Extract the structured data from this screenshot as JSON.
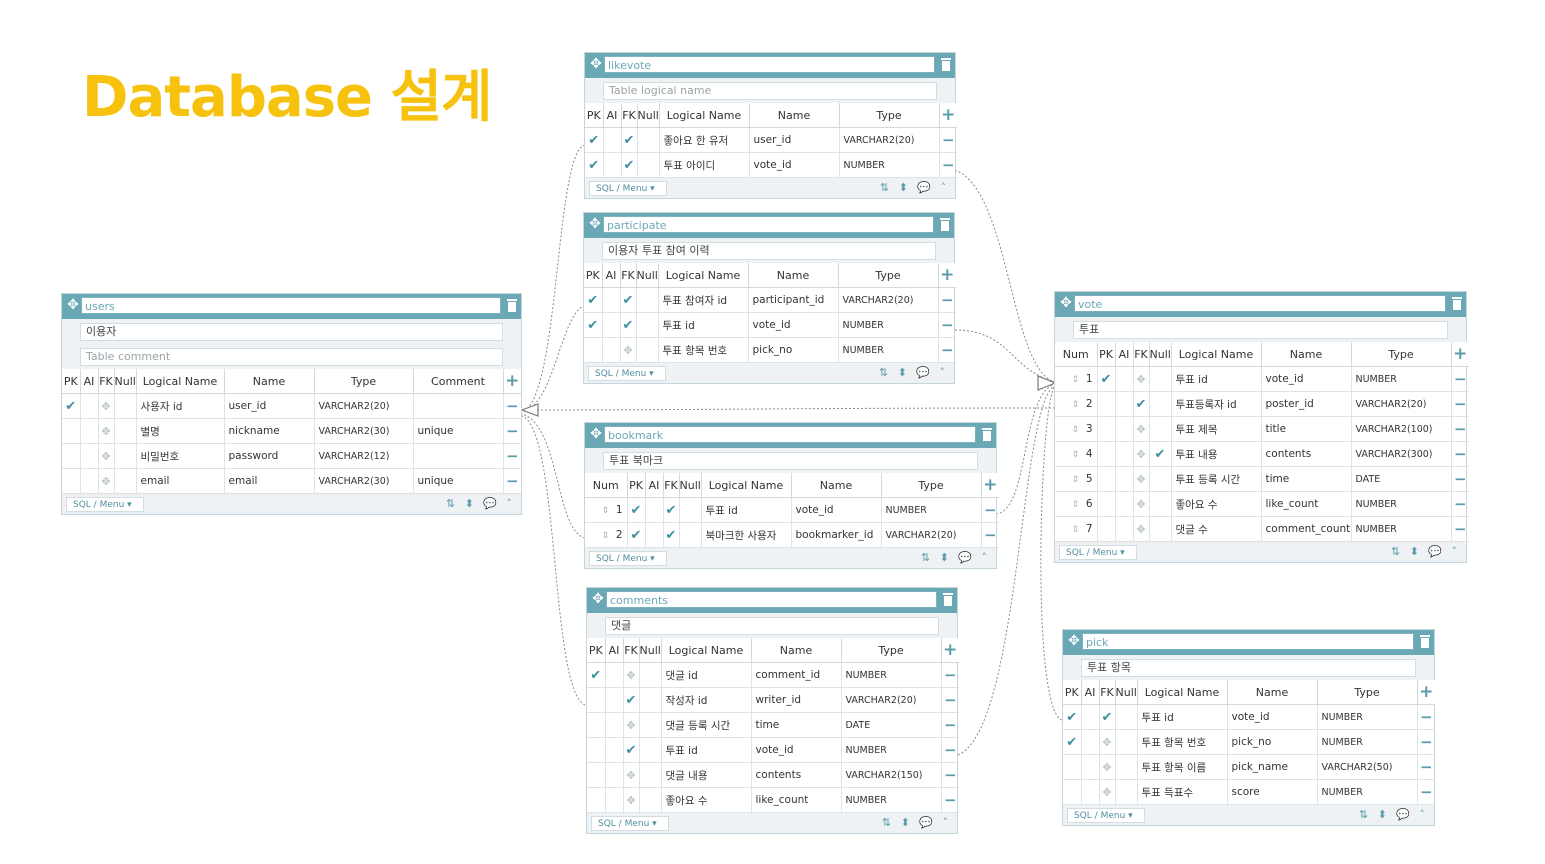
{
  "title": "Database 설계",
  "colors": {
    "header": "#6ba8b6",
    "accent": "#3f8ea0",
    "title": "#f7c20e"
  },
  "icons": {
    "move": "move-icon",
    "delete": "trash-icon",
    "check": "check-icon",
    "add": "plus-icon",
    "remove": "minus-icon",
    "sort": "sort-icon",
    "updown": "up-down-icon",
    "comment": "comment-icon",
    "collapse": "chevron-up-icon"
  },
  "ui": {
    "sql_menu": "SQL / Menu ▾",
    "footer_icons": "⇅ ⬍ 💬 ˄"
  },
  "tables": {
    "users": {
      "name": "users",
      "logical": "이용자",
      "comment_placeholder": "Table comment",
      "headers": {
        "pk": "PK",
        "ai": "AI",
        "fk": "FK",
        "null": "Null",
        "logical": "Logical Name",
        "name": "Name",
        "type": "Type",
        "comment": "Comment"
      },
      "rows": [
        {
          "pk": true,
          "fk": false,
          "logical": "사용자 id",
          "name": "user_id",
          "type": "VARCHAR2(20)",
          "comment": ""
        },
        {
          "pk": false,
          "fk": false,
          "logical": "별명",
          "name": "nickname",
          "type": "VARCHAR2(30)",
          "comment": "unique"
        },
        {
          "pk": false,
          "fk": false,
          "logical": "비밀번호",
          "name": "password",
          "type": "VARCHAR2(12)",
          "comment": ""
        },
        {
          "pk": false,
          "fk": false,
          "logical": "email",
          "name": "email",
          "type": "VARCHAR2(30)",
          "comment": "unique"
        }
      ]
    },
    "likevote": {
      "name": "likevote",
      "logical_placeholder": "Table logical name",
      "headers": {
        "pk": "PK",
        "ai": "AI",
        "fk": "FK",
        "null": "Null",
        "logical": "Logical Name",
        "name": "Name",
        "type": "Type"
      },
      "rows": [
        {
          "pk": true,
          "fk": true,
          "logical": "좋아요 한 유저",
          "name": "user_id",
          "type": "VARCHAR2(20)"
        },
        {
          "pk": true,
          "fk": true,
          "logical": "투표 아이디",
          "name": "vote_id",
          "type": "NUMBER"
        }
      ]
    },
    "participate": {
      "name": "participate",
      "logical": "이용자 투표 참여 이력",
      "headers": {
        "pk": "PK",
        "ai": "AI",
        "fk": "FK",
        "null": "Null",
        "logical": "Logical Name",
        "name": "Name",
        "type": "Type"
      },
      "rows": [
        {
          "pk": true,
          "fk": true,
          "logical": "투표 참여자 id",
          "name": "participant_id",
          "type": "VARCHAR2(20)"
        },
        {
          "pk": true,
          "fk": true,
          "logical": "투표 id",
          "name": "vote_id",
          "type": "NUMBER"
        },
        {
          "pk": false,
          "fk": false,
          "logical": "투표 항목 번호",
          "name": "pick_no",
          "type": "NUMBER"
        }
      ]
    },
    "bookmark": {
      "name": "bookmark",
      "logical": "투표 북마크",
      "headers": {
        "num": "Num",
        "pk": "PK",
        "ai": "AI",
        "fk": "FK",
        "null": "Null",
        "logical": "Logical Name",
        "name": "Name",
        "type": "Type"
      },
      "rows": [
        {
          "num": "1",
          "pk": true,
          "fk": true,
          "logical": "투표 id",
          "name": "vote_id",
          "type": "NUMBER"
        },
        {
          "num": "2",
          "pk": true,
          "fk": true,
          "logical": "북마크한 사용자",
          "name": "bookmarker_id",
          "type": "VARCHAR2(20)"
        }
      ]
    },
    "comments": {
      "name": "comments",
      "logical": "댓글",
      "headers": {
        "pk": "PK",
        "ai": "AI",
        "fk": "FK",
        "null": "Null",
        "logical": "Logical Name",
        "name": "Name",
        "type": "Type"
      },
      "rows": [
        {
          "pk": true,
          "fk": false,
          "logical": "댓글 id",
          "name": "comment_id",
          "type": "NUMBER"
        },
        {
          "pk": false,
          "fk": true,
          "logical": "작성자 id",
          "name": "writer_id",
          "type": "VARCHAR2(20)"
        },
        {
          "pk": false,
          "fk": false,
          "logical": "댓글 등록 시간",
          "name": "time",
          "type": "DATE"
        },
        {
          "pk": false,
          "fk": true,
          "logical": "투표 id",
          "name": "vote_id",
          "type": "NUMBER"
        },
        {
          "pk": false,
          "fk": false,
          "logical": "댓글 내용",
          "name": "contents",
          "type": "VARCHAR2(150)"
        },
        {
          "pk": false,
          "fk": false,
          "logical": "좋아요 수",
          "name": "like_count",
          "type": "NUMBER"
        }
      ]
    },
    "vote": {
      "name": "vote",
      "logical": "투표",
      "headers": {
        "num": "Num",
        "pk": "PK",
        "ai": "AI",
        "fk": "FK",
        "null": "Null",
        "logical": "Logical Name",
        "name": "Name",
        "type": "Type"
      },
      "rows": [
        {
          "num": "1",
          "pk": true,
          "fk": false,
          "null": false,
          "logical": "투표 id",
          "name": "vote_id",
          "type": "NUMBER"
        },
        {
          "num": "2",
          "pk": false,
          "fk": true,
          "null": false,
          "logical": "투표등록자 id",
          "name": "poster_id",
          "type": "VARCHAR2(20)"
        },
        {
          "num": "3",
          "pk": false,
          "fk": false,
          "null": false,
          "logical": "투표 제목",
          "name": "title",
          "type": "VARCHAR2(100)"
        },
        {
          "num": "4",
          "pk": false,
          "fk": false,
          "null": true,
          "logical": "투표 내용",
          "name": "contents",
          "type": "VARCHAR2(300)"
        },
        {
          "num": "5",
          "pk": false,
          "fk": false,
          "null": false,
          "logical": "투표 등록 시간",
          "name": "time",
          "type": "DATE"
        },
        {
          "num": "6",
          "pk": false,
          "fk": false,
          "null": false,
          "logical": "좋아요 수",
          "name": "like_count",
          "type": "NUMBER"
        },
        {
          "num": "7",
          "pk": false,
          "fk": false,
          "null": false,
          "logical": "댓글 수",
          "name": "comment_count",
          "type": "NUMBER"
        }
      ]
    },
    "pick": {
      "name": "pick",
      "logical": "투표 항목",
      "headers": {
        "pk": "PK",
        "ai": "AI",
        "fk": "FK",
        "null": "Null",
        "logical": "Logical Name",
        "name": "Name",
        "type": "Type"
      },
      "rows": [
        {
          "pk": true,
          "fk": true,
          "logical": "투표 id",
          "name": "vote_id",
          "type": "NUMBER"
        },
        {
          "pk": true,
          "fk": false,
          "logical": "투표 항목 번호",
          "name": "pick_no",
          "type": "NUMBER"
        },
        {
          "pk": false,
          "fk": false,
          "logical": "투표 항목 이름",
          "name": "pick_name",
          "type": "VARCHAR2(50)"
        },
        {
          "pk": false,
          "fk": false,
          "logical": "투표 득표수",
          "name": "score",
          "type": "NUMBER"
        }
      ]
    }
  }
}
